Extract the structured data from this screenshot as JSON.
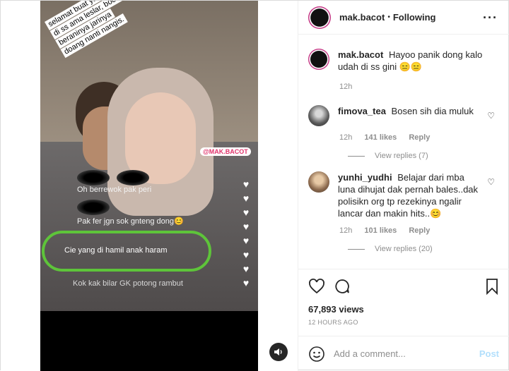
{
  "post": {
    "username": "mak.bacot",
    "separator": "•",
    "follow_status": "Following",
    "more_icon": "more-icon",
    "caption_username": "mak.bacot",
    "caption_text": "Hayoo panik dong kalo udah di ss gini 😑😑",
    "caption_time": "12h",
    "views": "67,893 views",
    "posted": "12 HOURS AGO",
    "add_comment_placeholder": "Add a comment...",
    "post_label": "Post"
  },
  "comments": [
    {
      "username": "fimova_tea",
      "text": "Bosen sih dia muluk",
      "time": "12h",
      "likes": "141 likes",
      "reply": "Reply",
      "view_replies": "View replies (7)"
    },
    {
      "username": "yunhi_yudhi",
      "text": "Belajar dari mba luna dihujat dak pernah bales..dak polisikn org tp rezekinya ngalir lancar dan makin hits..😊",
      "time": "12h",
      "likes": "101 likes",
      "reply": "Reply",
      "view_replies": "View replies (20)"
    }
  ],
  "video": {
    "sticker_lines": [
      "selamat buat yang tadi",
      "di ss ama leslar, bocil",
      "beraninya jarinya",
      "doang nanti nangis."
    ],
    "watermark": "@MAK.BACOT",
    "live_comments": [
      "Oh berrewok pak peri",
      "Pak fer jgn sok gnteng dong😊",
      "Cie yang di hamil anak haram",
      "Kok kak bilar GK potong rambut"
    ],
    "sound_icon": "speaker-icon"
  },
  "colors": {
    "highlight": "#5ec43a",
    "post_button": "#b2dffc",
    "watermark": "#e0336b"
  }
}
